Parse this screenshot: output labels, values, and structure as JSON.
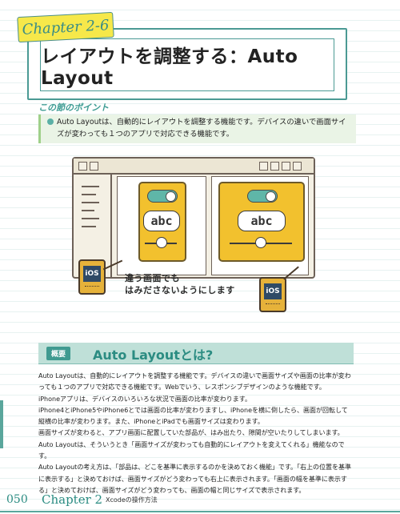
{
  "chapter": {
    "label": "Chapter 2-6"
  },
  "title": "レイアウトを調整する：Auto Layout",
  "points": {
    "heading": "この節のポイント",
    "text": "Auto Layoutは、自動的にレイアウトを調整する機能です。デバイスの違いで画面サイズが変わっても１つのアプリで対応できる機能です。"
  },
  "illustration": {
    "label_left": "abc",
    "label_right": "abc",
    "badge_left": "iOS",
    "badge_right": "iOS",
    "caption_line1": "違う画面でも",
    "caption_line2": "はみださないようにします"
  },
  "section": {
    "tag": "概要",
    "title": "Auto Layoutとは?"
  },
  "body": [
    "Auto Layoutは、自動的にレイアウトを調整する機能です。デバイスの違いで画面サイズや画面の比率が変わっても１つのアプリで対応できる機能です。Webでいう、レスポンシブデザインのような機能です。",
    "iPhoneアプリは、デバイスのいろいろな状況で画面の比率が変わります。",
    "iPhone4とiPhone5やiPhone6とでは画面の比率が変わりますし、iPhoneを横に倒したら、画面が回転して縦横の比率が変わります。また、iPhoneとiPadでも画面サイズは変わります。",
    "画面サイズが変わると、アプリ画面に配置していた部品が、はみ出たり、隙間が空いたりしてしまいます。",
    "Auto Layoutは、そういうとき「画面サイズが変わっても自動的にレイアウトを変えてくれる」機能なのです。",
    "Auto Layoutの考え方は、「部品は、どこを基準に表示するのかを決めておく機能」です。「右上の位置を基準に表示する」と決めておけば、画面サイズがどう変わっても右上に表示されます。「画面の幅を基準に表示する」と決めておけば、画面サイズがどう変わっても、画面の幅と同じサイズで表示されます。"
  ],
  "footer": {
    "page_number": "050",
    "chapter": "Chapter 2",
    "subtitle": "Xcodeの操作方法"
  }
}
